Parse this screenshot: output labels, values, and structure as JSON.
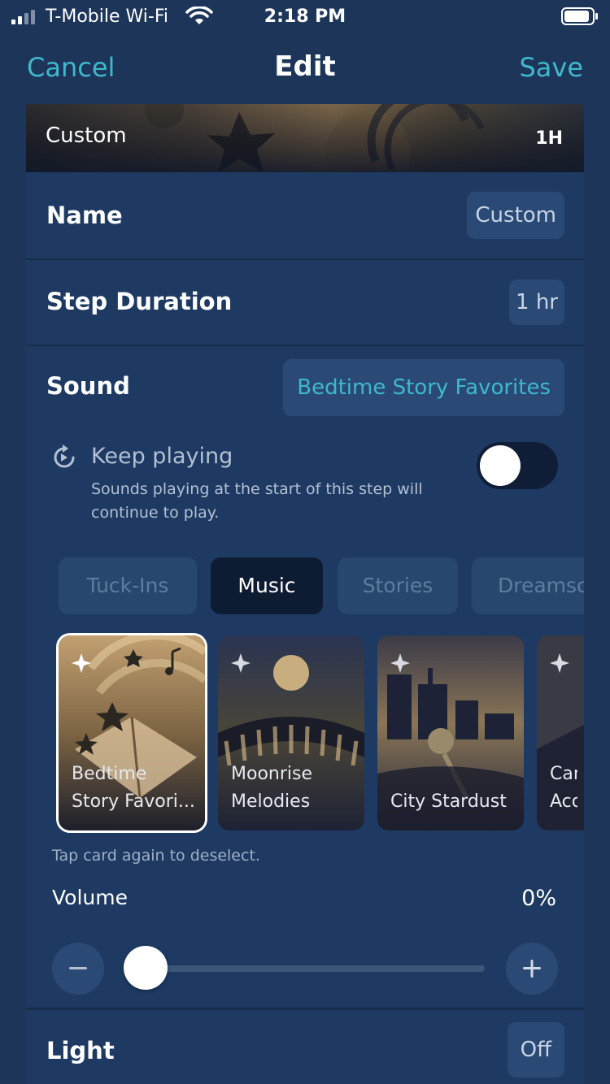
{
  "status_bar": {
    "carrier": "T-Mobile Wi-Fi",
    "time": "2:18 PM"
  },
  "nav": {
    "cancel": "Cancel",
    "title": "Edit",
    "save": "Save"
  },
  "hero": {
    "label": "Custom",
    "duration": "1H"
  },
  "name_row": {
    "label": "Name",
    "value": "Custom"
  },
  "duration_row": {
    "label": "Step Duration",
    "value": "1 hr"
  },
  "sound_row": {
    "label": "Sound",
    "value": "Bedtime Story Favorites"
  },
  "keep_playing": {
    "title": "Keep playing",
    "description": "Sounds playing at the start of this step will continue to play.",
    "enabled": false
  },
  "tabs": [
    {
      "label": "Tuck-Ins",
      "active": false
    },
    {
      "label": "Music",
      "active": true
    },
    {
      "label": "Stories",
      "active": false
    },
    {
      "label": "Dreamscapes",
      "active": false
    }
  ],
  "sound_cards": [
    {
      "line1": "Bedtime",
      "line2": "Story Favori...",
      "selected": true
    },
    {
      "line1": "Moonrise",
      "line2": "Melodies",
      "selected": false
    },
    {
      "line1": "",
      "line2": "City Stardust",
      "selected": false
    },
    {
      "line1": "Can",
      "line2": "Aco",
      "selected": false
    }
  ],
  "hint": "Tap card again to deselect.",
  "volume": {
    "label": "Volume",
    "value": "0%",
    "level": 0
  },
  "light_row": {
    "label": "Light",
    "value": "Off"
  },
  "colors": {
    "accent": "#3fb8cc",
    "background": "#1c3559",
    "card": "#1e3a62"
  }
}
